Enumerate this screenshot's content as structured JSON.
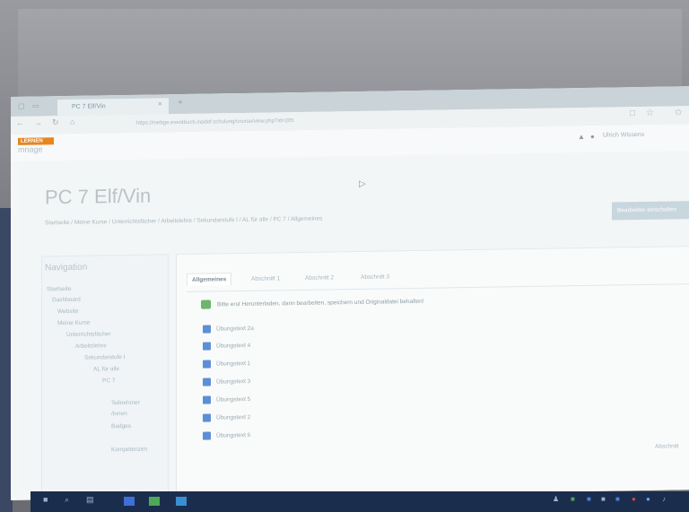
{
  "browser": {
    "tab_title": "PC 7 Elf/Vin",
    "tab_close": "×",
    "new_tab": "+",
    "url": "https://mebge.eventbuch.inadef.schulung/course/view.php?id=205",
    "back_icon": "arrow-left-icon",
    "forward_icon": "arrow-right-icon",
    "refresh_icon": "refresh-icon",
    "home_icon": "home-icon"
  },
  "header": {
    "logo_top": "LERNEN",
    "logo_bottom": "mnage",
    "user_name": "Ulrich Wissens"
  },
  "course": {
    "title": "PC 7 Elf/Vin",
    "breadcrumb": "Startseite / Meine Kurse / Unterrichtsfächer / Arbeitslehre / Sekundarstufe I / AL für alle / PC 7 / Allgemeines",
    "edit_button": "Bearbeiten einschalten"
  },
  "navigation": {
    "heading": "Navigation",
    "items": [
      {
        "label": "Startseite"
      },
      {
        "label": "Dashboard"
      },
      {
        "label": "Website"
      },
      {
        "label": "Meine Kurse"
      },
      {
        "label": "Unterrichtsfächer"
      },
      {
        "label": "Arbeitslehre"
      },
      {
        "label": "Sekundarstufe I"
      },
      {
        "label": "AL für alle"
      },
      {
        "label": "PC 7"
      },
      {
        "label": "Teilnehmer"
      },
      {
        "label": "/innen"
      },
      {
        "label": "Badges"
      },
      {
        "label": "Kompetenzen"
      }
    ]
  },
  "sections": {
    "tabs": [
      "Allgemeines",
      "Abschnitt 1",
      "Abschnitt 2",
      "Abschnitt 3"
    ],
    "active_tab": "Allgemeines",
    "notice": "Bitte erst Herunterladen, dann bearbeiten, speichern und Originaldatei behalten!",
    "resources": [
      "Übungstext 2a",
      "Übungstext 4",
      "Übungstext 1",
      "Übungstext 3",
      "Übungstext 5",
      "Übungstext 2",
      "Übungstext 6"
    ],
    "footer_link": "Abschnitt"
  }
}
